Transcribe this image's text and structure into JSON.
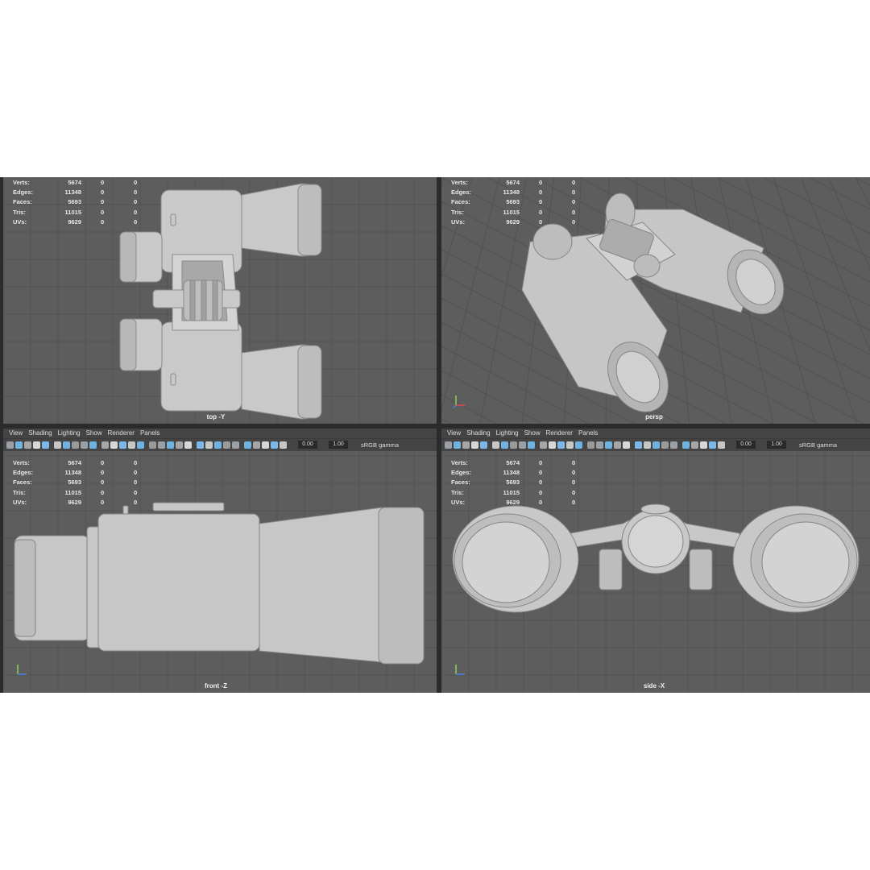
{
  "stats": {
    "rows": [
      {
        "label": "Verts:",
        "v1": "5674",
        "v2": "0",
        "v3": "0"
      },
      {
        "label": "Edges:",
        "v1": "11348",
        "v2": "0",
        "v3": "0"
      },
      {
        "label": "Faces:",
        "v1": "5693",
        "v2": "0",
        "v3": "0"
      },
      {
        "label": "Tris:",
        "v1": "11015",
        "v2": "0",
        "v3": "0"
      },
      {
        "label": "UVs:",
        "v1": "9629",
        "v2": "0",
        "v3": "0"
      }
    ]
  },
  "viewports": {
    "top": {
      "name": "top -Y"
    },
    "persp": {
      "name": "persp"
    },
    "front": {
      "name": "front -Z"
    },
    "side": {
      "name": "side -X"
    }
  },
  "panel_menu": [
    "View",
    "Shading",
    "Lighting",
    "Show",
    "Renderer",
    "Panels"
  ],
  "toolbar": {
    "exposure": "0.00",
    "gamma": "1.00",
    "color_space": "sRGB gamma"
  },
  "colors": {
    "viewport_bg": "#5d5d5d",
    "grid": "#525252",
    "model": "#c8c8c8",
    "accent": "#3fa5d8"
  }
}
